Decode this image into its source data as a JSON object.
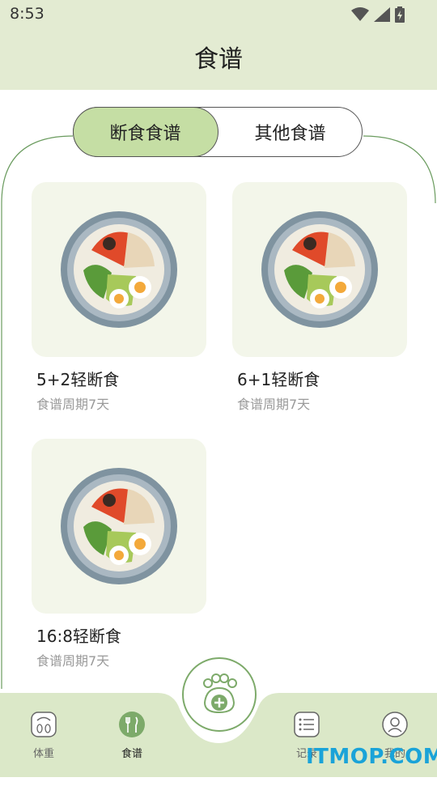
{
  "status": {
    "time": "8:53"
  },
  "header": {
    "title": "食谱"
  },
  "tabs": [
    {
      "label": "断食食谱",
      "active": true
    },
    {
      "label": "其他食谱",
      "active": false
    }
  ],
  "recipes": [
    {
      "title": "5+2轻断食",
      "subtitle": "食谱周期7天"
    },
    {
      "title": "6+1轻断食",
      "subtitle": "食谱周期7天"
    },
    {
      "title": "16:8轻断食",
      "subtitle": "食谱周期7天"
    }
  ],
  "nav": {
    "items": [
      {
        "label": "体重",
        "icon": "scale-icon"
      },
      {
        "label": "食谱",
        "icon": "fork-knife-icon",
        "active": true
      },
      {
        "label": "记录",
        "icon": "list-icon"
      },
      {
        "label": "我的",
        "icon": "profile-icon"
      }
    ],
    "fab_icon": "paw-add-icon"
  },
  "colors": {
    "header_bg": "#e3ebd2",
    "accent": "#c5dea4",
    "nav_bg": "#dbe8c8"
  },
  "watermark": "ITMOP.COM"
}
